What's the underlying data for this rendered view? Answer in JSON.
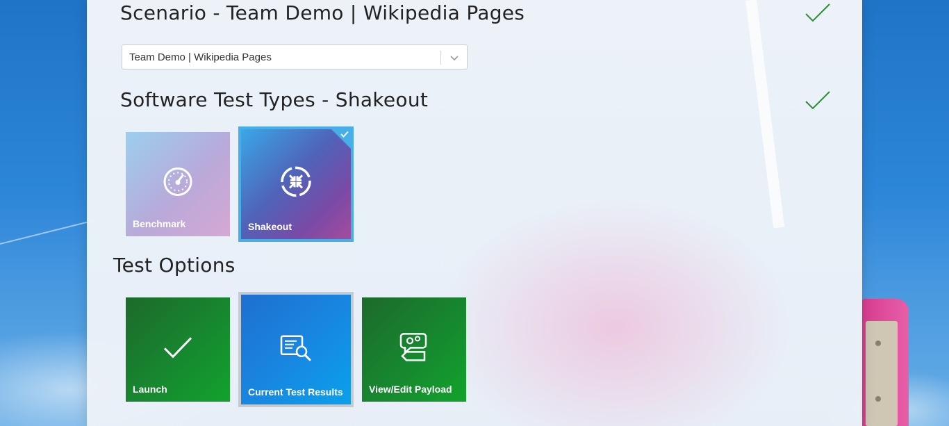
{
  "scenario": {
    "title": "Scenario - Team Demo | Wikipedia Pages",
    "selected_value": "Team Demo | Wikipedia Pages"
  },
  "test_types": {
    "title": "Software Test Types - Shakeout",
    "tiles": [
      {
        "label": "Benchmark",
        "icon": "speedometer-icon",
        "selected": false
      },
      {
        "label": "Shakeout",
        "icon": "shakeout-arrows-icon",
        "selected": true
      }
    ]
  },
  "test_options": {
    "title": "Test Options",
    "tiles": [
      {
        "label": "Launch",
        "icon": "checkmark-icon"
      },
      {
        "label": "Current Test Results",
        "icon": "document-search-icon"
      },
      {
        "label": "View/Edit Payload",
        "icon": "payload-gear-icon"
      }
    ]
  },
  "colors": {
    "complete_check": "#2e8b3a",
    "selected_border": "#47aee8",
    "green_tile": "#17852f",
    "blue_tile": "#1886e0"
  }
}
